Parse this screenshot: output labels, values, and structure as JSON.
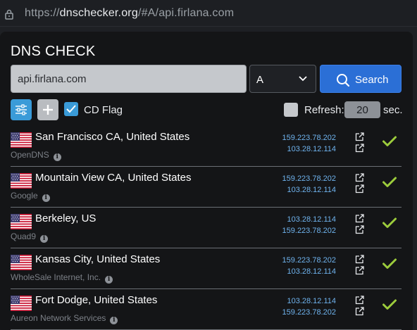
{
  "browser": {
    "url_prefix": "https://",
    "url_host": "dnschecker.org",
    "url_path": "/#A/api.firlana.com"
  },
  "page": {
    "title": "DNS CHECK"
  },
  "search": {
    "domain_value": "api.firlana.com",
    "record_type": "A",
    "button_label": "Search"
  },
  "options": {
    "cd_flag_label": "CD Flag",
    "cd_flag_checked": true,
    "refresh_label": "Refresh:",
    "refresh_value": "20",
    "refresh_unit": "sec.",
    "refresh_checked": false
  },
  "results": [
    {
      "location": "San Francisco CA, United States",
      "provider": "OpenDNS",
      "ips": [
        "159.223.78.202",
        "103.28.12.114"
      ],
      "status": "ok"
    },
    {
      "location": "Mountain View CA, United States",
      "provider": "Google",
      "ips": [
        "159.223.78.202",
        "103.28.12.114"
      ],
      "status": "ok"
    },
    {
      "location": "Berkeley, US",
      "provider": "Quad9",
      "ips": [
        "103.28.12.114",
        "159.223.78.202"
      ],
      "status": "ok"
    },
    {
      "location": "Kansas City, United States",
      "provider": "WholeSale Internet, Inc.",
      "ips": [
        "159.223.78.202",
        "103.28.12.114"
      ],
      "status": "ok"
    },
    {
      "location": "Fort Dodge, United States",
      "provider": "Aureon Network Services",
      "ips": [
        "103.28.12.114",
        "159.223.78.202"
      ],
      "status": "ok"
    }
  ],
  "icons": {
    "lock": "lock-icon",
    "search": "search-icon",
    "options": "sliders-icon",
    "add": "plus-icon",
    "check": "checkmark-icon",
    "flag": "us-flag-icon",
    "info": "info-icon",
    "external": "external-link-icon",
    "status": "check-icon"
  },
  "colors": {
    "accent_blue": "#2b6fd6",
    "ip_link": "#6fb3ee",
    "status_ok": "#9ccc3c"
  }
}
